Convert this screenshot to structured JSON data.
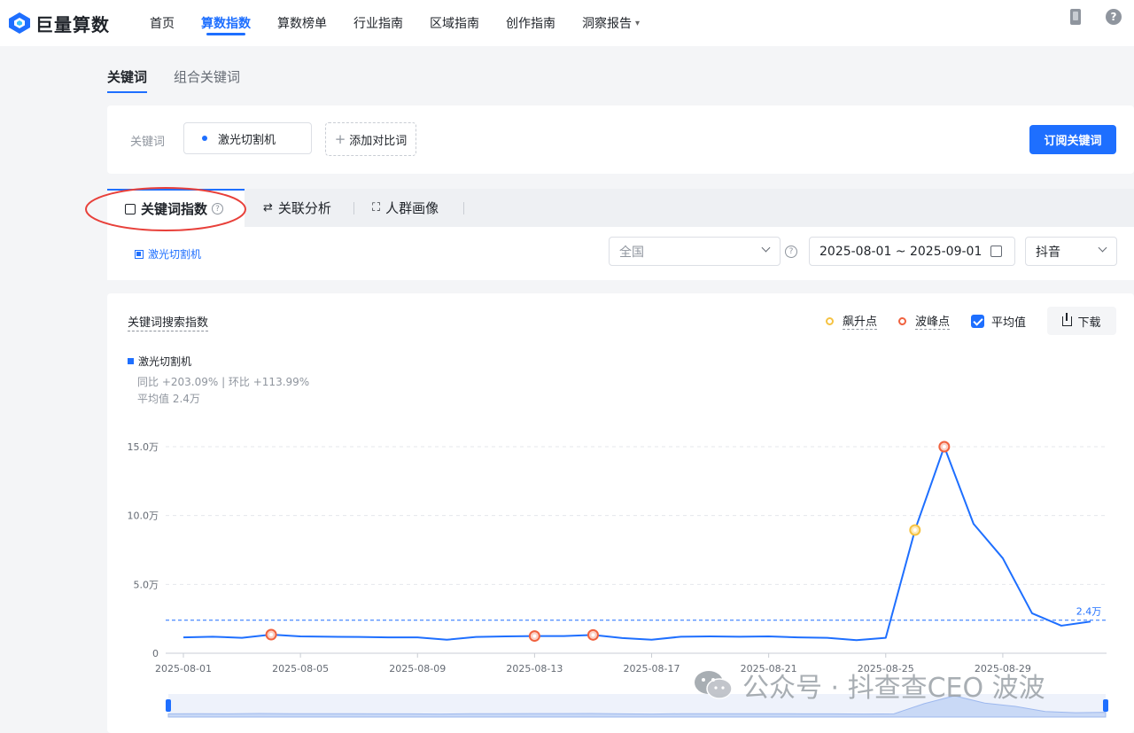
{
  "brand": {
    "name": "巨量算数"
  },
  "nav": [
    {
      "label": "首页",
      "active": false
    },
    {
      "label": "算数指数",
      "active": true
    },
    {
      "label": "算数榜单",
      "active": false
    },
    {
      "label": "行业指南",
      "active": false
    },
    {
      "label": "区域指南",
      "active": false
    },
    {
      "label": "创作指南",
      "active": false
    },
    {
      "label": "洞察报告",
      "active": false,
      "caret": "▾"
    }
  ],
  "header_icons": [
    "phone-icon",
    "help-icon"
  ],
  "help_glyph": "?",
  "subtabs": [
    {
      "label": "关键词",
      "active": true
    },
    {
      "label": "组合关键词",
      "active": false
    }
  ],
  "keyword_card": {
    "label": "关键词",
    "keyword": "激光切割机",
    "add_compare": "添加对比词",
    "add_plus": "+",
    "subscribe": "订阅关键词"
  },
  "analysis_tabs": [
    {
      "label": "关键词指数",
      "active": true,
      "icon": "trend-chart-icon"
    },
    {
      "label": "关联分析",
      "active": false,
      "icon": "relation-icon",
      "glyph": "⇄"
    },
    {
      "label": "人群画像",
      "active": false,
      "icon": "portrait-icon",
      "glyph": "⛶"
    }
  ],
  "filters": {
    "legend_label": "激光切割机",
    "region": "全国",
    "region_help": "?",
    "date_range": "2025-08-01 ~ 2025-09-01",
    "platform": "抖音"
  },
  "chart_panel": {
    "title": "关键词搜索指数",
    "controls": {
      "rise": "飙升点",
      "peak": "波峰点",
      "average": "平均值",
      "average_checked": true,
      "download": "下载"
    },
    "series_name": "激光切割机",
    "stat_line": "同比 +203.09% | 环比 +113.99%",
    "avg_line": "平均值 2.4万"
  },
  "watermark": {
    "text": "公众号 · 抖查查CEO 波波"
  },
  "colors": {
    "accent": "#1e6fff",
    "rise": "#f5c242",
    "peak": "#f0623f",
    "annotation": "#e8403a"
  },
  "chart_data": {
    "type": "line",
    "x": [
      "2025-08-01",
      "2025-08-02",
      "2025-08-03",
      "2025-08-04",
      "2025-08-05",
      "2025-08-06",
      "2025-08-07",
      "2025-08-08",
      "2025-08-09",
      "2025-08-10",
      "2025-08-11",
      "2025-08-12",
      "2025-08-13",
      "2025-08-14",
      "2025-08-15",
      "2025-08-16",
      "2025-08-17",
      "2025-08-18",
      "2025-08-19",
      "2025-08-20",
      "2025-08-21",
      "2025-08-22",
      "2025-08-23",
      "2025-08-24",
      "2025-08-25",
      "2025-08-26",
      "2025-08-27",
      "2025-08-28",
      "2025-08-29",
      "2025-08-30",
      "2025-08-31",
      "2025-09-01"
    ],
    "x_tick_labels": [
      "2025-08-01",
      "2025-08-05",
      "2025-08-09",
      "2025-08-13",
      "2025-08-17",
      "2025-08-21",
      "2025-08-25",
      "2025-08-29"
    ],
    "series": [
      {
        "name": "激光切割机",
        "values": [
          1.15,
          1.2,
          1.12,
          1.35,
          1.22,
          1.2,
          1.18,
          1.15,
          1.15,
          0.98,
          1.18,
          1.22,
          1.25,
          1.25,
          1.33,
          1.1,
          0.98,
          1.2,
          1.22,
          1.2,
          1.22,
          1.15,
          1.12,
          0.95,
          1.12,
          8.95,
          15.0,
          9.4,
          6.9,
          2.9,
          2.0,
          2.3
        ]
      }
    ],
    "y_unit": "万",
    "y_ticks": [
      0,
      5.0,
      10.0,
      15.0
    ],
    "y_tick_labels": [
      "0",
      "5.0万",
      "10.0万",
      "15.0万"
    ],
    "ylim": [
      0,
      15.0
    ],
    "average": 2.4,
    "average_label": "2.4万",
    "peak_points": [
      "2025-08-04",
      "2025-08-13",
      "2025-08-15",
      "2025-08-27"
    ],
    "rise_points": [
      "2025-08-26"
    ],
    "grid": true,
    "legend_placement": "top-left"
  }
}
